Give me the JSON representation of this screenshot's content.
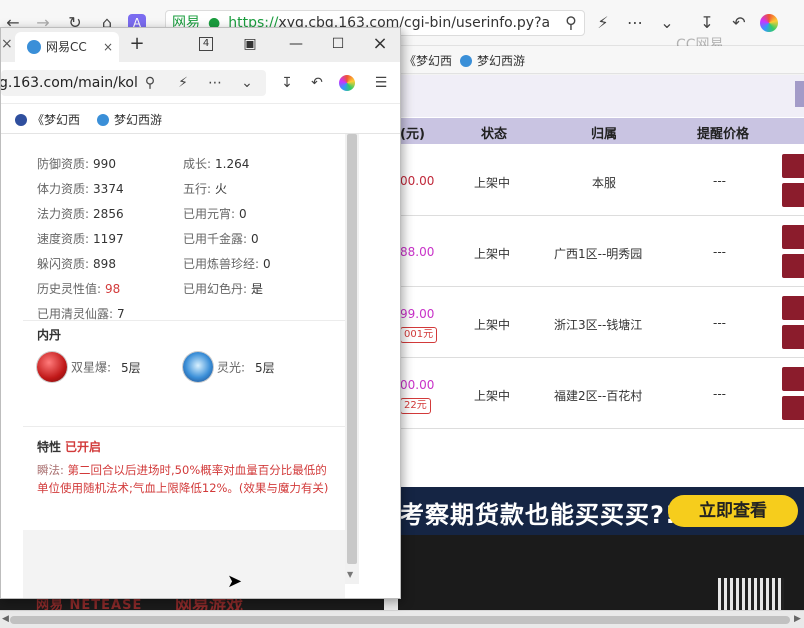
{
  "bg_window": {
    "url_secure_label": "网易",
    "url_https": "https://",
    "url_rest": "xyq.cbg.163.com/cgi-bin/userinfo.py?a",
    "bookmarks": [
      "《梦幻西",
      "梦幻西游"
    ],
    "watermark": "CC网易",
    "table": {
      "headers": [
        "(元)",
        "状态",
        "归属",
        "提醒价格"
      ],
      "rows": [
        {
          "price": "00.00",
          "tag": "",
          "status": "上架中",
          "owner": "本服",
          "remind": "---"
        },
        {
          "price": "88.00",
          "tag": "",
          "status": "上架中",
          "owner": "广西1区--明秀园",
          "remind": "---"
        },
        {
          "price": "99.00",
          "tag": "001元",
          "status": "上架中",
          "owner": "浙江3区--钱塘江",
          "remind": "---"
        },
        {
          "price": "00.00",
          "tag": "22元",
          "status": "上架中",
          "owner": "福建2区--百花村",
          "remind": "---"
        }
      ]
    },
    "ad": {
      "text": "考察期货款也能买买买?!",
      "button": "立即查看"
    },
    "footer": {
      "logo": "网易 NETEASE",
      "game": "网易游戏"
    }
  },
  "popup": {
    "tab_title": "网易CC",
    "tab_count": "4",
    "url": "g.163.com/main/kol",
    "bookmarks": [
      "《梦幻西",
      "梦幻西游"
    ],
    "attributes": [
      {
        "label": "防御资质:",
        "value": "990",
        "col": 0,
        "row": -1
      },
      {
        "label": "成长:",
        "value": "1.264",
        "col": 1,
        "row": -1
      },
      {
        "label": "体力资质:",
        "value": "3374",
        "col": 0,
        "row": 0
      },
      {
        "label": "五行:",
        "value": "火",
        "col": 1,
        "row": 0
      },
      {
        "label": "法力资质:",
        "value": "2856",
        "col": 0,
        "row": 1
      },
      {
        "label": "已用元宵:",
        "value": "0",
        "col": 1,
        "row": 1
      },
      {
        "label": "速度资质:",
        "value": "1197",
        "col": 0,
        "row": 2
      },
      {
        "label": "已用千金露:",
        "value": "0",
        "col": 1,
        "row": 2
      },
      {
        "label": "躲闪资质:",
        "value": "898",
        "col": 0,
        "row": 3
      },
      {
        "label": "已用炼兽珍经:",
        "value": "0",
        "col": 1,
        "row": 3
      },
      {
        "label": "历史灵性值:",
        "value": "98",
        "col": 0,
        "row": 4,
        "red": true
      },
      {
        "label": "已用幻色丹:",
        "value": "是",
        "col": 1,
        "row": 4
      },
      {
        "label": "已用清灵仙露:",
        "value": "7",
        "col": 0,
        "row": 5
      }
    ],
    "neidan_title": "内丹",
    "neidan": [
      {
        "name": "双星爆:",
        "level": "5层"
      },
      {
        "name": "灵光:",
        "level": "5层"
      }
    ],
    "trait": {
      "title": "特性",
      "status": "已开启",
      "label": "瞬法:",
      "desc": "第二回合以后进场时,50%概率对血量百分比最低的单位使用随机法术;气血上限降低12%。(效果与魔力有关)"
    }
  },
  "colors": {
    "accent_red": "#d23a3a",
    "table_header": "#c9c4e2",
    "action_button": "#8b1c2c",
    "ad_button": "#f6cd1c"
  }
}
